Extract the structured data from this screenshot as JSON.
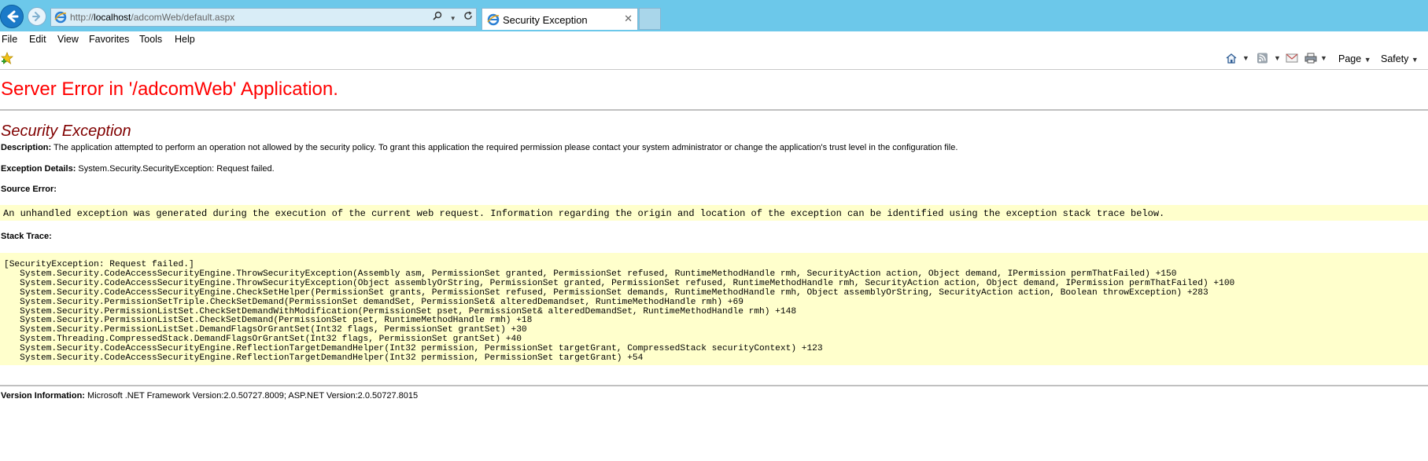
{
  "browser": {
    "address": {
      "prefix": "http://",
      "host": "localhost",
      "path": "/adcomWeb/default.aspx"
    },
    "tab_title": "Security Exception",
    "menu": [
      "File",
      "Edit",
      "View",
      "Favorites",
      "Tools",
      "Help"
    ],
    "command_bar": {
      "page_label": "Page",
      "safety_label": "Safety"
    }
  },
  "page": {
    "error_title": "Server Error in '/adcomWeb' Application.",
    "exception_title": "Security Exception",
    "description_label": "Description:",
    "description_text": " The application attempted to perform an operation not allowed by the security policy.  To grant this application the required permission please contact your system administrator or change the application's trust level in the configuration file.",
    "exception_details_label": "Exception Details:",
    "exception_details_text": " System.Security.SecurityException: Request failed.",
    "source_error_label": "Source Error:",
    "source_error_text": "An unhandled exception was generated during the execution of the current web request. Information regarding the origin and location of the exception can be identified using the exception stack trace below.",
    "stack_trace_label": "Stack Trace:",
    "stack_trace": "[SecurityException: Request failed.]\n   System.Security.CodeAccessSecurityEngine.ThrowSecurityException(Assembly asm, PermissionSet granted, PermissionSet refused, RuntimeMethodHandle rmh, SecurityAction action, Object demand, IPermission permThatFailed) +150\n   System.Security.CodeAccessSecurityEngine.ThrowSecurityException(Object assemblyOrString, PermissionSet granted, PermissionSet refused, RuntimeMethodHandle rmh, SecurityAction action, Object demand, IPermission permThatFailed) +100\n   System.Security.CodeAccessSecurityEngine.CheckSetHelper(PermissionSet grants, PermissionSet refused, PermissionSet demands, RuntimeMethodHandle rmh, Object assemblyOrString, SecurityAction action, Boolean throwException) +283\n   System.Security.PermissionSetTriple.CheckSetDemand(PermissionSet demandSet, PermissionSet& alteredDemandset, RuntimeMethodHandle rmh) +69\n   System.Security.PermissionListSet.CheckSetDemandWithModification(PermissionSet pset, PermissionSet& alteredDemandSet, RuntimeMethodHandle rmh) +148\n   System.Security.PermissionListSet.CheckSetDemand(PermissionSet pset, RuntimeMethodHandle rmh) +18\n   System.Security.PermissionListSet.DemandFlagsOrGrantSet(Int32 flags, PermissionSet grantSet) +30\n   System.Threading.CompressedStack.DemandFlagsOrGrantSet(Int32 flags, PermissionSet grantSet) +40\n   System.Security.CodeAccessSecurityEngine.ReflectionTargetDemandHelper(Int32 permission, PermissionSet targetGrant, CompressedStack securityContext) +123\n   System.Security.CodeAccessSecurityEngine.ReflectionTargetDemandHelper(Int32 permission, PermissionSet targetGrant) +54",
    "version_label": "Version Information:",
    "version_text": " Microsoft .NET Framework Version:2.0.50727.8009; ASP.NET Version:2.0.50727.8015"
  },
  "colors": {
    "titlebar": "#6cc8ea",
    "error_title": "#ff0000",
    "exception_title": "#800000",
    "code_background": "#ffffcc"
  }
}
